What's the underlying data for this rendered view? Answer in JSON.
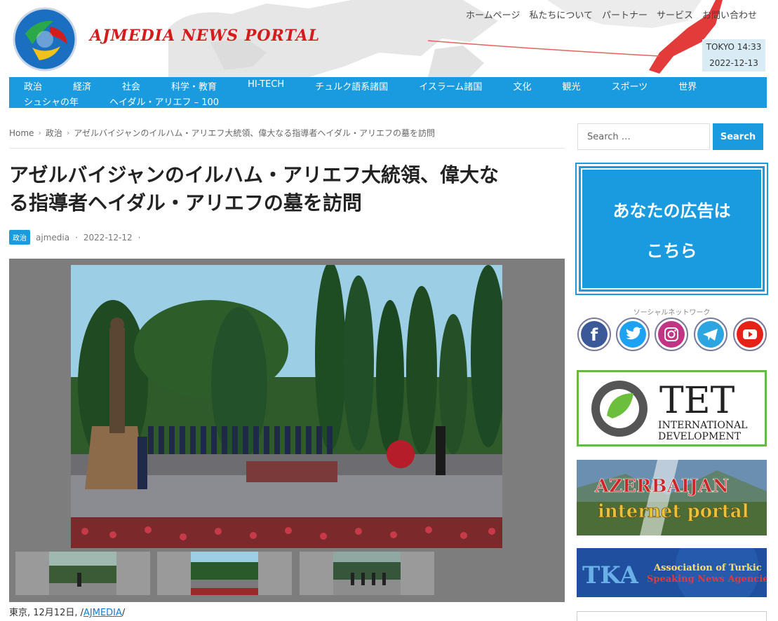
{
  "header": {
    "logo_text": "AJMEDIA NEWS PORTAL",
    "top_nav": [
      "ホームページ",
      "私たちについて",
      "パートナー",
      "サービス",
      "お問い合わせ"
    ],
    "clock": {
      "city_time": "TOKYO 14:33",
      "date": "2022-12-13"
    }
  },
  "main_nav": {
    "row1": [
      "政治",
      "経済",
      "社会",
      "科学・教育",
      "HI-TECH",
      "チュルク語系諸国",
      "イスラーム諸国",
      "文化",
      "観光",
      "スポーツ",
      "世界"
    ],
    "row2": [
      "シュシャの年",
      "ヘイダル・アリエフ – 100"
    ]
  },
  "breadcrumb": {
    "home": "Home",
    "category": "政治",
    "current": "アゼルバイジャンのイルハム・アリエフ大統領、偉大なる指導者ヘイダル・アリエフの墓を訪問"
  },
  "article": {
    "title_line1": "アゼルバイジャンのイルハム・アリエフ大統領、偉大な",
    "title_line2": "る指導者ヘイダル・アリエフの墓を訪問",
    "category_badge": "政治",
    "author": "ajmedia",
    "dot1": "·",
    "date": "2022-12-12",
    "dot2": "·",
    "caption_prefix": "東京, 12月12日, /",
    "caption_link": "AJMEDIA",
    "caption_suffix": "/"
  },
  "sidebar": {
    "search_placeholder": "Search …",
    "search_button": "Search",
    "ad_line1": "あなたの広告は",
    "ad_line2": "こちら",
    "social_title": "ソーシャルネットワーク",
    "social_icons": [
      "facebook-icon",
      "twitter-icon",
      "instagram-icon",
      "telegram-icon",
      "youtube-icon"
    ],
    "tet_brand": "TET",
    "tet_sub1": "INTERNATIONAL",
    "tet_sub2": "DEVELOPMENT",
    "aip_line1": "AZERBAIJAN",
    "aip_line2": "internet portal",
    "tka_logo": "TKA",
    "tka_line1": "Association of Turkic",
    "tka_line2": "Speaking News Agencies"
  },
  "colors": {
    "accent": "#1a9be0",
    "logo_red": "#d41c1c",
    "tet_green": "#66b847"
  }
}
